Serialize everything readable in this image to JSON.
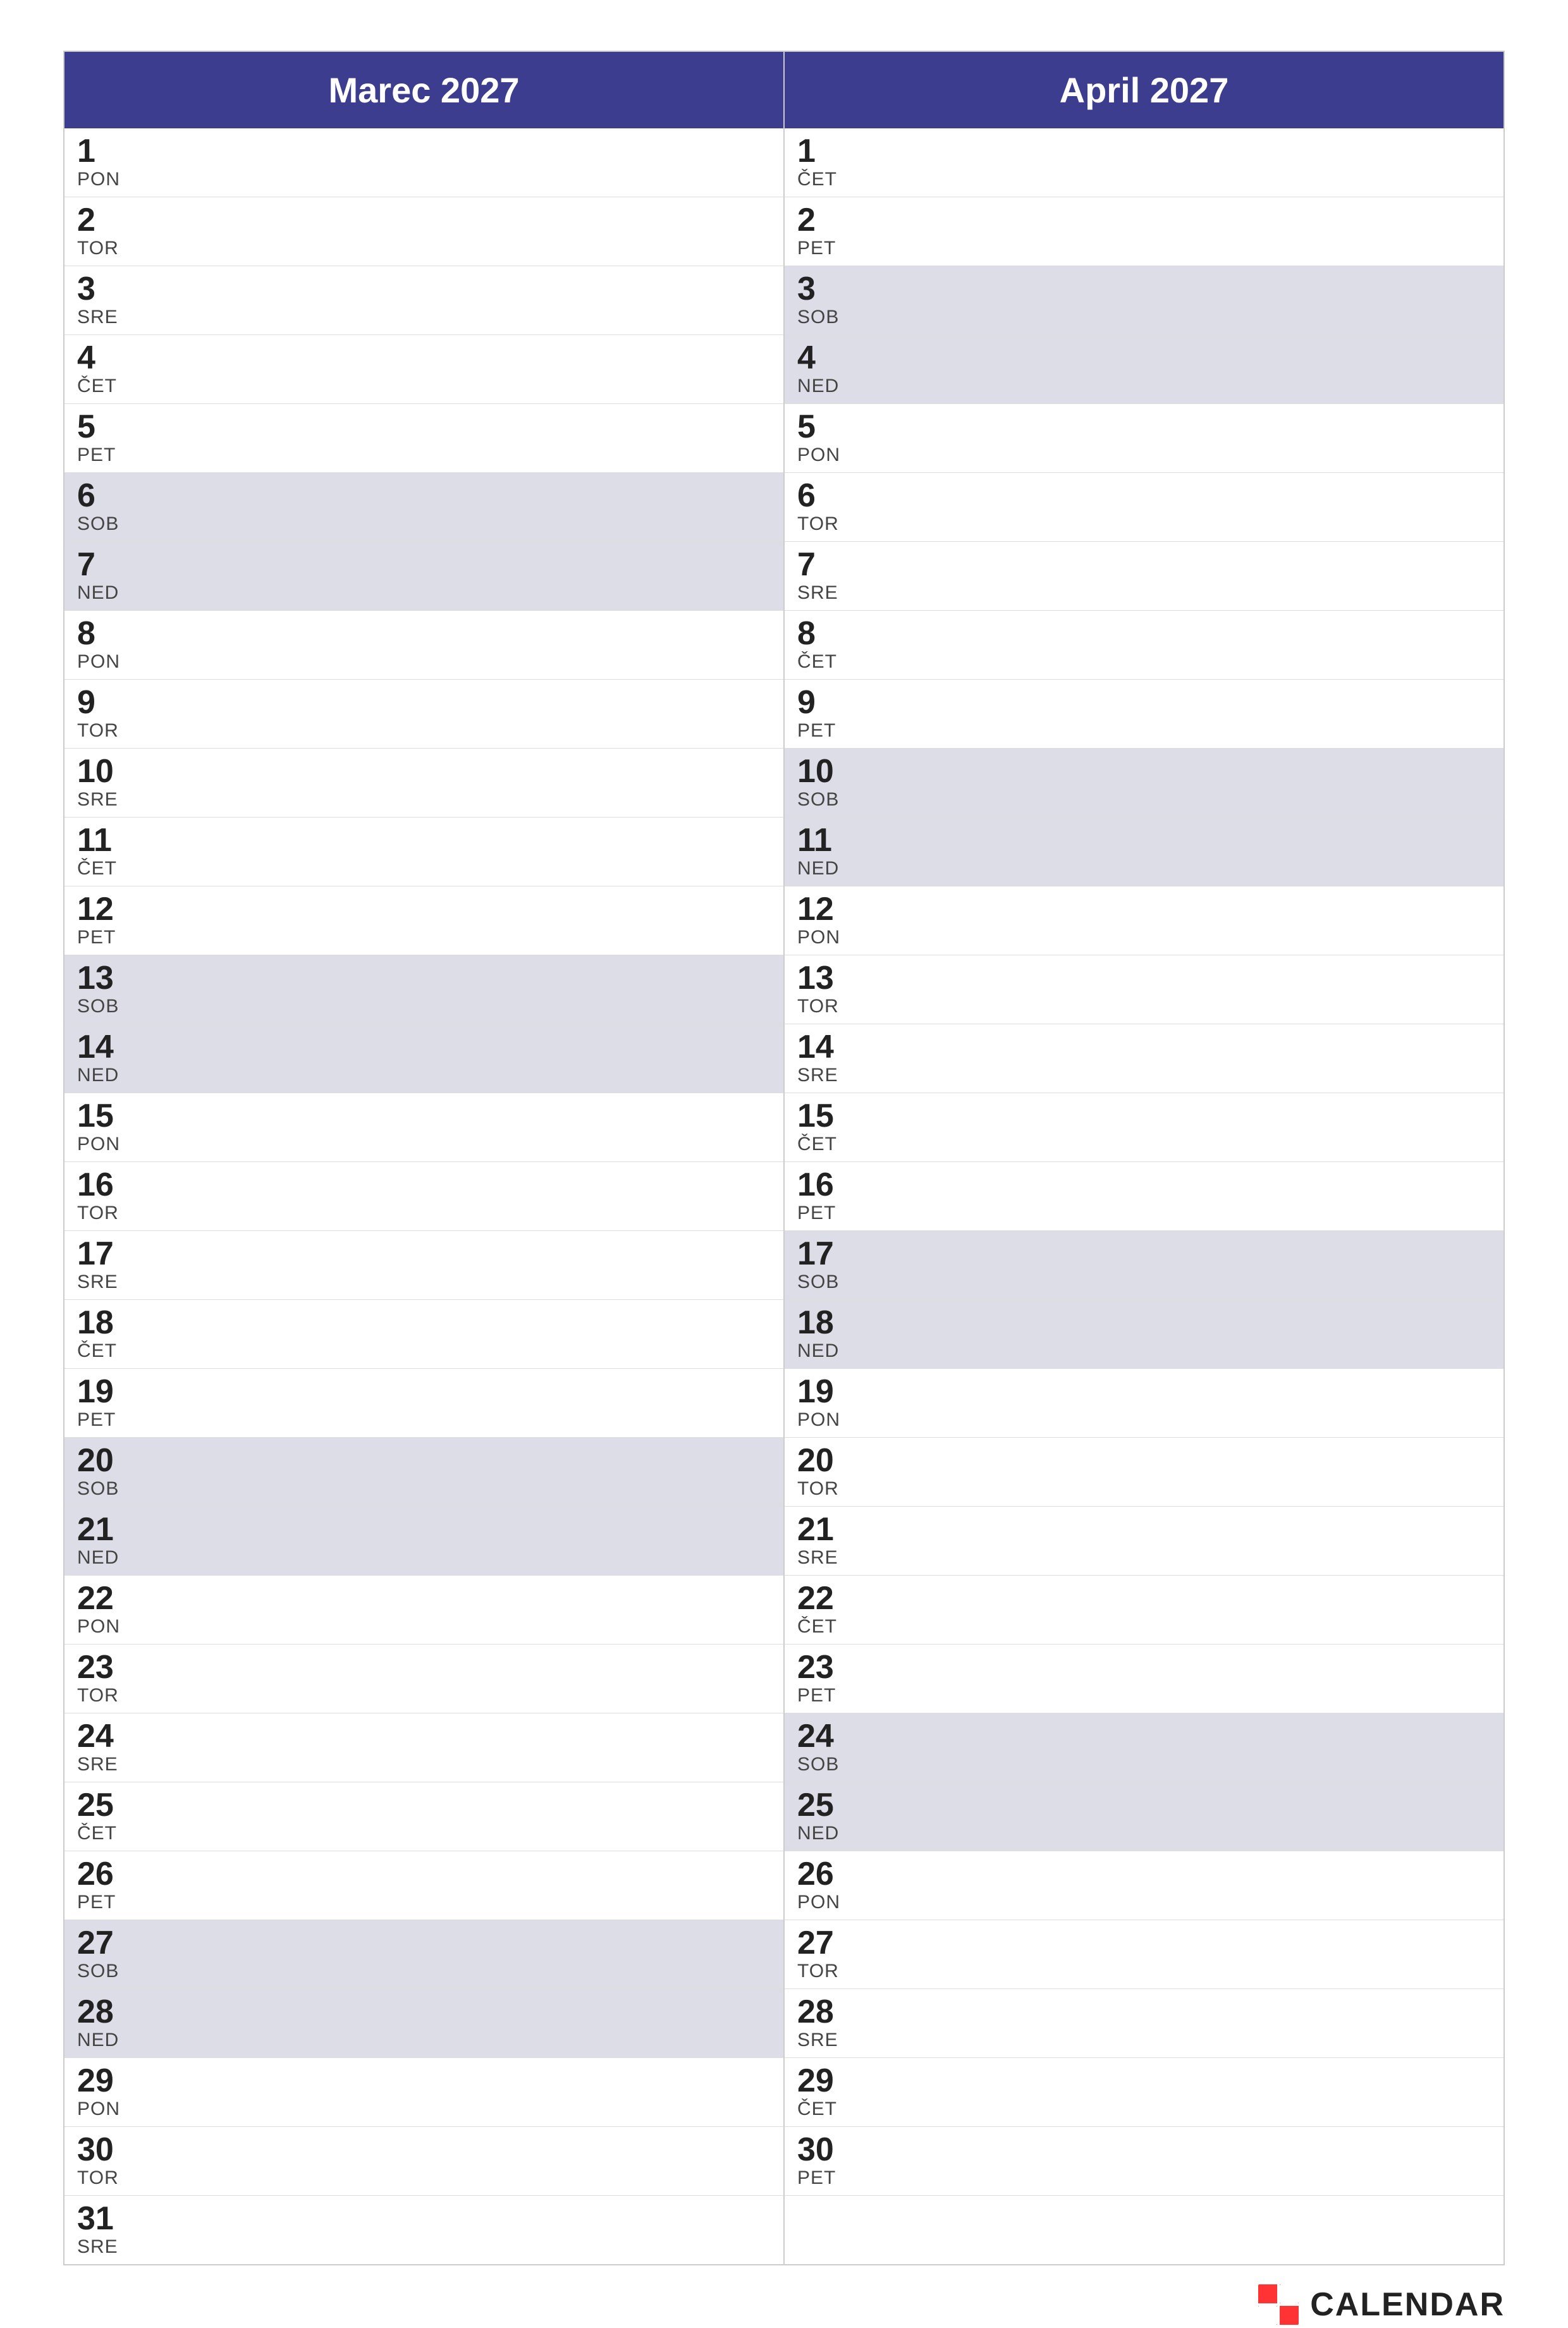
{
  "months": [
    {
      "title": "Marec 2027",
      "days": [
        {
          "num": "1",
          "name": "PON",
          "weekend": false
        },
        {
          "num": "2",
          "name": "TOR",
          "weekend": false
        },
        {
          "num": "3",
          "name": "SRE",
          "weekend": false
        },
        {
          "num": "4",
          "name": "ČET",
          "weekend": false
        },
        {
          "num": "5",
          "name": "PET",
          "weekend": false
        },
        {
          "num": "6",
          "name": "SOB",
          "weekend": true
        },
        {
          "num": "7",
          "name": "NED",
          "weekend": true
        },
        {
          "num": "8",
          "name": "PON",
          "weekend": false
        },
        {
          "num": "9",
          "name": "TOR",
          "weekend": false
        },
        {
          "num": "10",
          "name": "SRE",
          "weekend": false
        },
        {
          "num": "11",
          "name": "ČET",
          "weekend": false
        },
        {
          "num": "12",
          "name": "PET",
          "weekend": false
        },
        {
          "num": "13",
          "name": "SOB",
          "weekend": true
        },
        {
          "num": "14",
          "name": "NED",
          "weekend": true
        },
        {
          "num": "15",
          "name": "PON",
          "weekend": false
        },
        {
          "num": "16",
          "name": "TOR",
          "weekend": false
        },
        {
          "num": "17",
          "name": "SRE",
          "weekend": false
        },
        {
          "num": "18",
          "name": "ČET",
          "weekend": false
        },
        {
          "num": "19",
          "name": "PET",
          "weekend": false
        },
        {
          "num": "20",
          "name": "SOB",
          "weekend": true
        },
        {
          "num": "21",
          "name": "NED",
          "weekend": true
        },
        {
          "num": "22",
          "name": "PON",
          "weekend": false
        },
        {
          "num": "23",
          "name": "TOR",
          "weekend": false
        },
        {
          "num": "24",
          "name": "SRE",
          "weekend": false
        },
        {
          "num": "25",
          "name": "ČET",
          "weekend": false
        },
        {
          "num": "26",
          "name": "PET",
          "weekend": false
        },
        {
          "num": "27",
          "name": "SOB",
          "weekend": true
        },
        {
          "num": "28",
          "name": "NED",
          "weekend": true
        },
        {
          "num": "29",
          "name": "PON",
          "weekend": false
        },
        {
          "num": "30",
          "name": "TOR",
          "weekend": false
        },
        {
          "num": "31",
          "name": "SRE",
          "weekend": false
        }
      ]
    },
    {
      "title": "April 2027",
      "days": [
        {
          "num": "1",
          "name": "ČET",
          "weekend": false
        },
        {
          "num": "2",
          "name": "PET",
          "weekend": false
        },
        {
          "num": "3",
          "name": "SOB",
          "weekend": true
        },
        {
          "num": "4",
          "name": "NED",
          "weekend": true
        },
        {
          "num": "5",
          "name": "PON",
          "weekend": false
        },
        {
          "num": "6",
          "name": "TOR",
          "weekend": false
        },
        {
          "num": "7",
          "name": "SRE",
          "weekend": false
        },
        {
          "num": "8",
          "name": "ČET",
          "weekend": false
        },
        {
          "num": "9",
          "name": "PET",
          "weekend": false
        },
        {
          "num": "10",
          "name": "SOB",
          "weekend": true
        },
        {
          "num": "11",
          "name": "NED",
          "weekend": true
        },
        {
          "num": "12",
          "name": "PON",
          "weekend": false
        },
        {
          "num": "13",
          "name": "TOR",
          "weekend": false
        },
        {
          "num": "14",
          "name": "SRE",
          "weekend": false
        },
        {
          "num": "15",
          "name": "ČET",
          "weekend": false
        },
        {
          "num": "16",
          "name": "PET",
          "weekend": false
        },
        {
          "num": "17",
          "name": "SOB",
          "weekend": true
        },
        {
          "num": "18",
          "name": "NED",
          "weekend": true
        },
        {
          "num": "19",
          "name": "PON",
          "weekend": false
        },
        {
          "num": "20",
          "name": "TOR",
          "weekend": false
        },
        {
          "num": "21",
          "name": "SRE",
          "weekend": false
        },
        {
          "num": "22",
          "name": "ČET",
          "weekend": false
        },
        {
          "num": "23",
          "name": "PET",
          "weekend": false
        },
        {
          "num": "24",
          "name": "SOB",
          "weekend": true
        },
        {
          "num": "25",
          "name": "NED",
          "weekend": true
        },
        {
          "num": "26",
          "name": "PON",
          "weekend": false
        },
        {
          "num": "27",
          "name": "TOR",
          "weekend": false
        },
        {
          "num": "28",
          "name": "SRE",
          "weekend": false
        },
        {
          "num": "29",
          "name": "ČET",
          "weekend": false
        },
        {
          "num": "30",
          "name": "PET",
          "weekend": false
        }
      ]
    }
  ],
  "brand": {
    "label": "CALENDAR"
  }
}
